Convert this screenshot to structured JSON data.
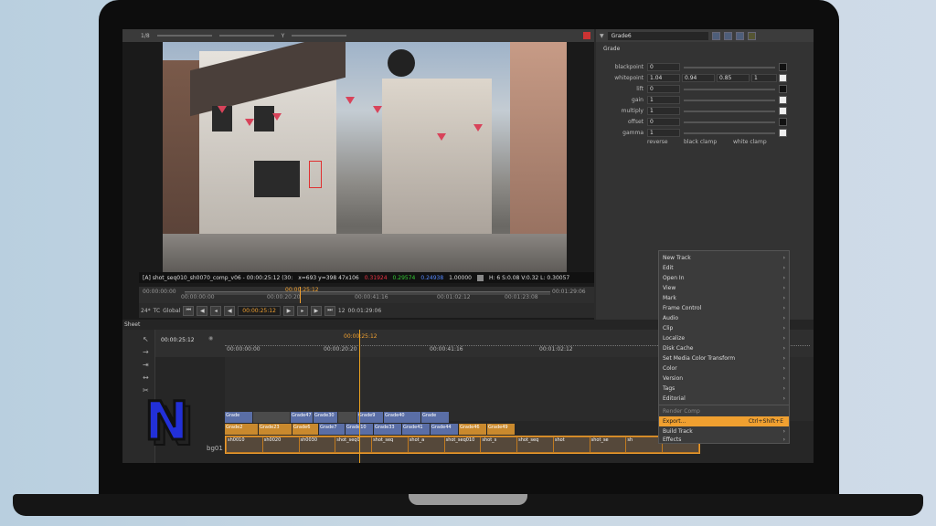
{
  "viewer": {
    "frame_counter": "1/8",
    "channel": "Y",
    "info": {
      "clip": "[A] shot_seq010_sh0070_comp_v06 - 00:00:25:12 (30:",
      "coords": "x=693 y=398 47x106",
      "r": "0.31924",
      "g": "0.29574",
      "b": "0.24938",
      "a": "1.00000",
      "hsvl": "H: 6 S:0.08 V:0.32 L: 0.30057"
    },
    "ruler": {
      "start": "00:00:00:00",
      "current": "00:00:25:12",
      "end": "00:01:29:06",
      "tick1": "00:00:00:00",
      "tick2": "00:00:20:20",
      "tick3": "00:00:41:16",
      "tick4": "00:01:02:12",
      "tick5": "00:01:23:08",
      "end_right": "00:01:29:06"
    },
    "transport": {
      "zoom": "24*",
      "tc": "TC",
      "global": "Global",
      "timecode": "00:00:25:12",
      "step": "12",
      "end_timecode": "00:01:29:06"
    }
  },
  "properties": {
    "node_name": "Grade6",
    "section": "Grade",
    "rows": [
      {
        "label": "blackpoint",
        "v1": "0"
      },
      {
        "label": "whitepoint",
        "v1": "1.04",
        "v2": "0.94",
        "v3": "0.85",
        "v4": "1"
      },
      {
        "label": "lift",
        "v1": "0"
      },
      {
        "label": "gain",
        "v1": "1"
      },
      {
        "label": "multiply",
        "v1": "1"
      },
      {
        "label": "offset",
        "v1": "0"
      },
      {
        "label": "gamma",
        "v1": "1"
      }
    ],
    "checks": {
      "reverse": "reverse",
      "black_clamp": "black clamp",
      "white_clamp": "white clamp"
    }
  },
  "sheet": {
    "tab": "Sheet",
    "timecode": "00:00:25:12",
    "marks": [
      "00:00:00:00",
      "00:00:20:20",
      "00:00:41:16",
      "00:01:02:12"
    ],
    "playhead": "00:00:25:12",
    "track_name": "bg01",
    "clips_row1": [
      "Grade",
      "Grade47",
      "Grade30",
      "Grade9",
      "Grade40",
      "Grade"
    ],
    "clips_row2": [
      "Grade2",
      "Grade23",
      "Grade6",
      "Grade7",
      "Grade10",
      "Grade33",
      "Grade41",
      "Grade44",
      "Grade46",
      "Grade49"
    ],
    "film_labels": [
      "sh0010",
      "sh0020",
      "sh0030",
      "shot_seq0",
      "shot_seq",
      "shot_a",
      "shot_seq010",
      "shot_s",
      "shot_seq",
      "shot",
      "shot_se",
      "sh",
      "shot_a"
    ]
  },
  "menu": {
    "items": [
      {
        "label": "New Track",
        "sub": true
      },
      {
        "label": "Edit",
        "sub": true
      },
      {
        "label": "Open In",
        "sub": true
      },
      {
        "label": "View",
        "sub": true
      },
      {
        "label": "Mark",
        "sub": true
      },
      {
        "label": "Frame Control",
        "sub": true
      },
      {
        "label": "Audio",
        "sub": true
      },
      {
        "label": "Clip",
        "sub": true
      },
      {
        "label": "Localize",
        "sub": true
      },
      {
        "label": "Disk Cache",
        "sub": true
      },
      {
        "label": "Set Media Color Transform",
        "sub": true
      },
      {
        "label": "Color",
        "sub": true
      },
      {
        "label": "Version",
        "sub": true
      },
      {
        "label": "Tags",
        "sub": true
      },
      {
        "label": "Editorial",
        "sub": true
      },
      {
        "label": "Render Comp",
        "dim": true
      },
      {
        "label": "Export...",
        "shortcut": "Ctrl+Shift+E",
        "highlight": true
      },
      {
        "label": "Build Track",
        "sub": true
      },
      {
        "label": "Effects",
        "sub": true
      }
    ]
  },
  "logo": {
    "letter": "N"
  },
  "colors": {
    "accent": "#f0a030",
    "highlight": "#f0a030",
    "logo_blue": "#2230d8"
  }
}
